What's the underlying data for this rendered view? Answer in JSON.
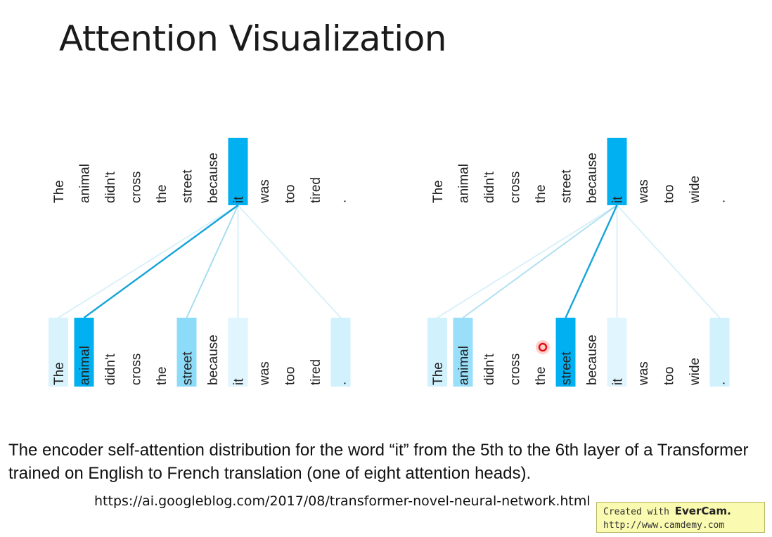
{
  "title": "Attention Visualization",
  "diagrams": [
    {
      "words": [
        "The",
        "animal",
        "didn't",
        "cross",
        "the",
        "street",
        "because",
        "it",
        "was",
        "too",
        "tired",
        "."
      ],
      "focus_index": 7,
      "attention": [
        0.15,
        1.0,
        0.0,
        0.0,
        0.0,
        0.45,
        0.0,
        0.12,
        0.0,
        0.0,
        0.0,
        0.18
      ]
    },
    {
      "words": [
        "The",
        "animal",
        "didn't",
        "cross",
        "the",
        "street",
        "because",
        "it",
        "was",
        "too",
        "wide",
        "."
      ],
      "focus_index": 7,
      "attention": [
        0.18,
        0.4,
        0.0,
        0.0,
        0.0,
        1.0,
        0.0,
        0.12,
        0.0,
        0.0,
        0.0,
        0.18
      ]
    }
  ],
  "colors": {
    "accent": "#00b0f0",
    "line": "#0a9fd8"
  },
  "caption": "The encoder self-attention distribution for the word “it” from the 5th to the 6th layer of a Transformer trained on English to French translation (one of eight attention heads).",
  "url": "https://ai.googleblog.com/2017/08/transformer-novel-neural-network.html",
  "watermark": {
    "prefix": "Created with",
    "brand": "EverCam.",
    "url": "http://www.camdemy.com"
  }
}
